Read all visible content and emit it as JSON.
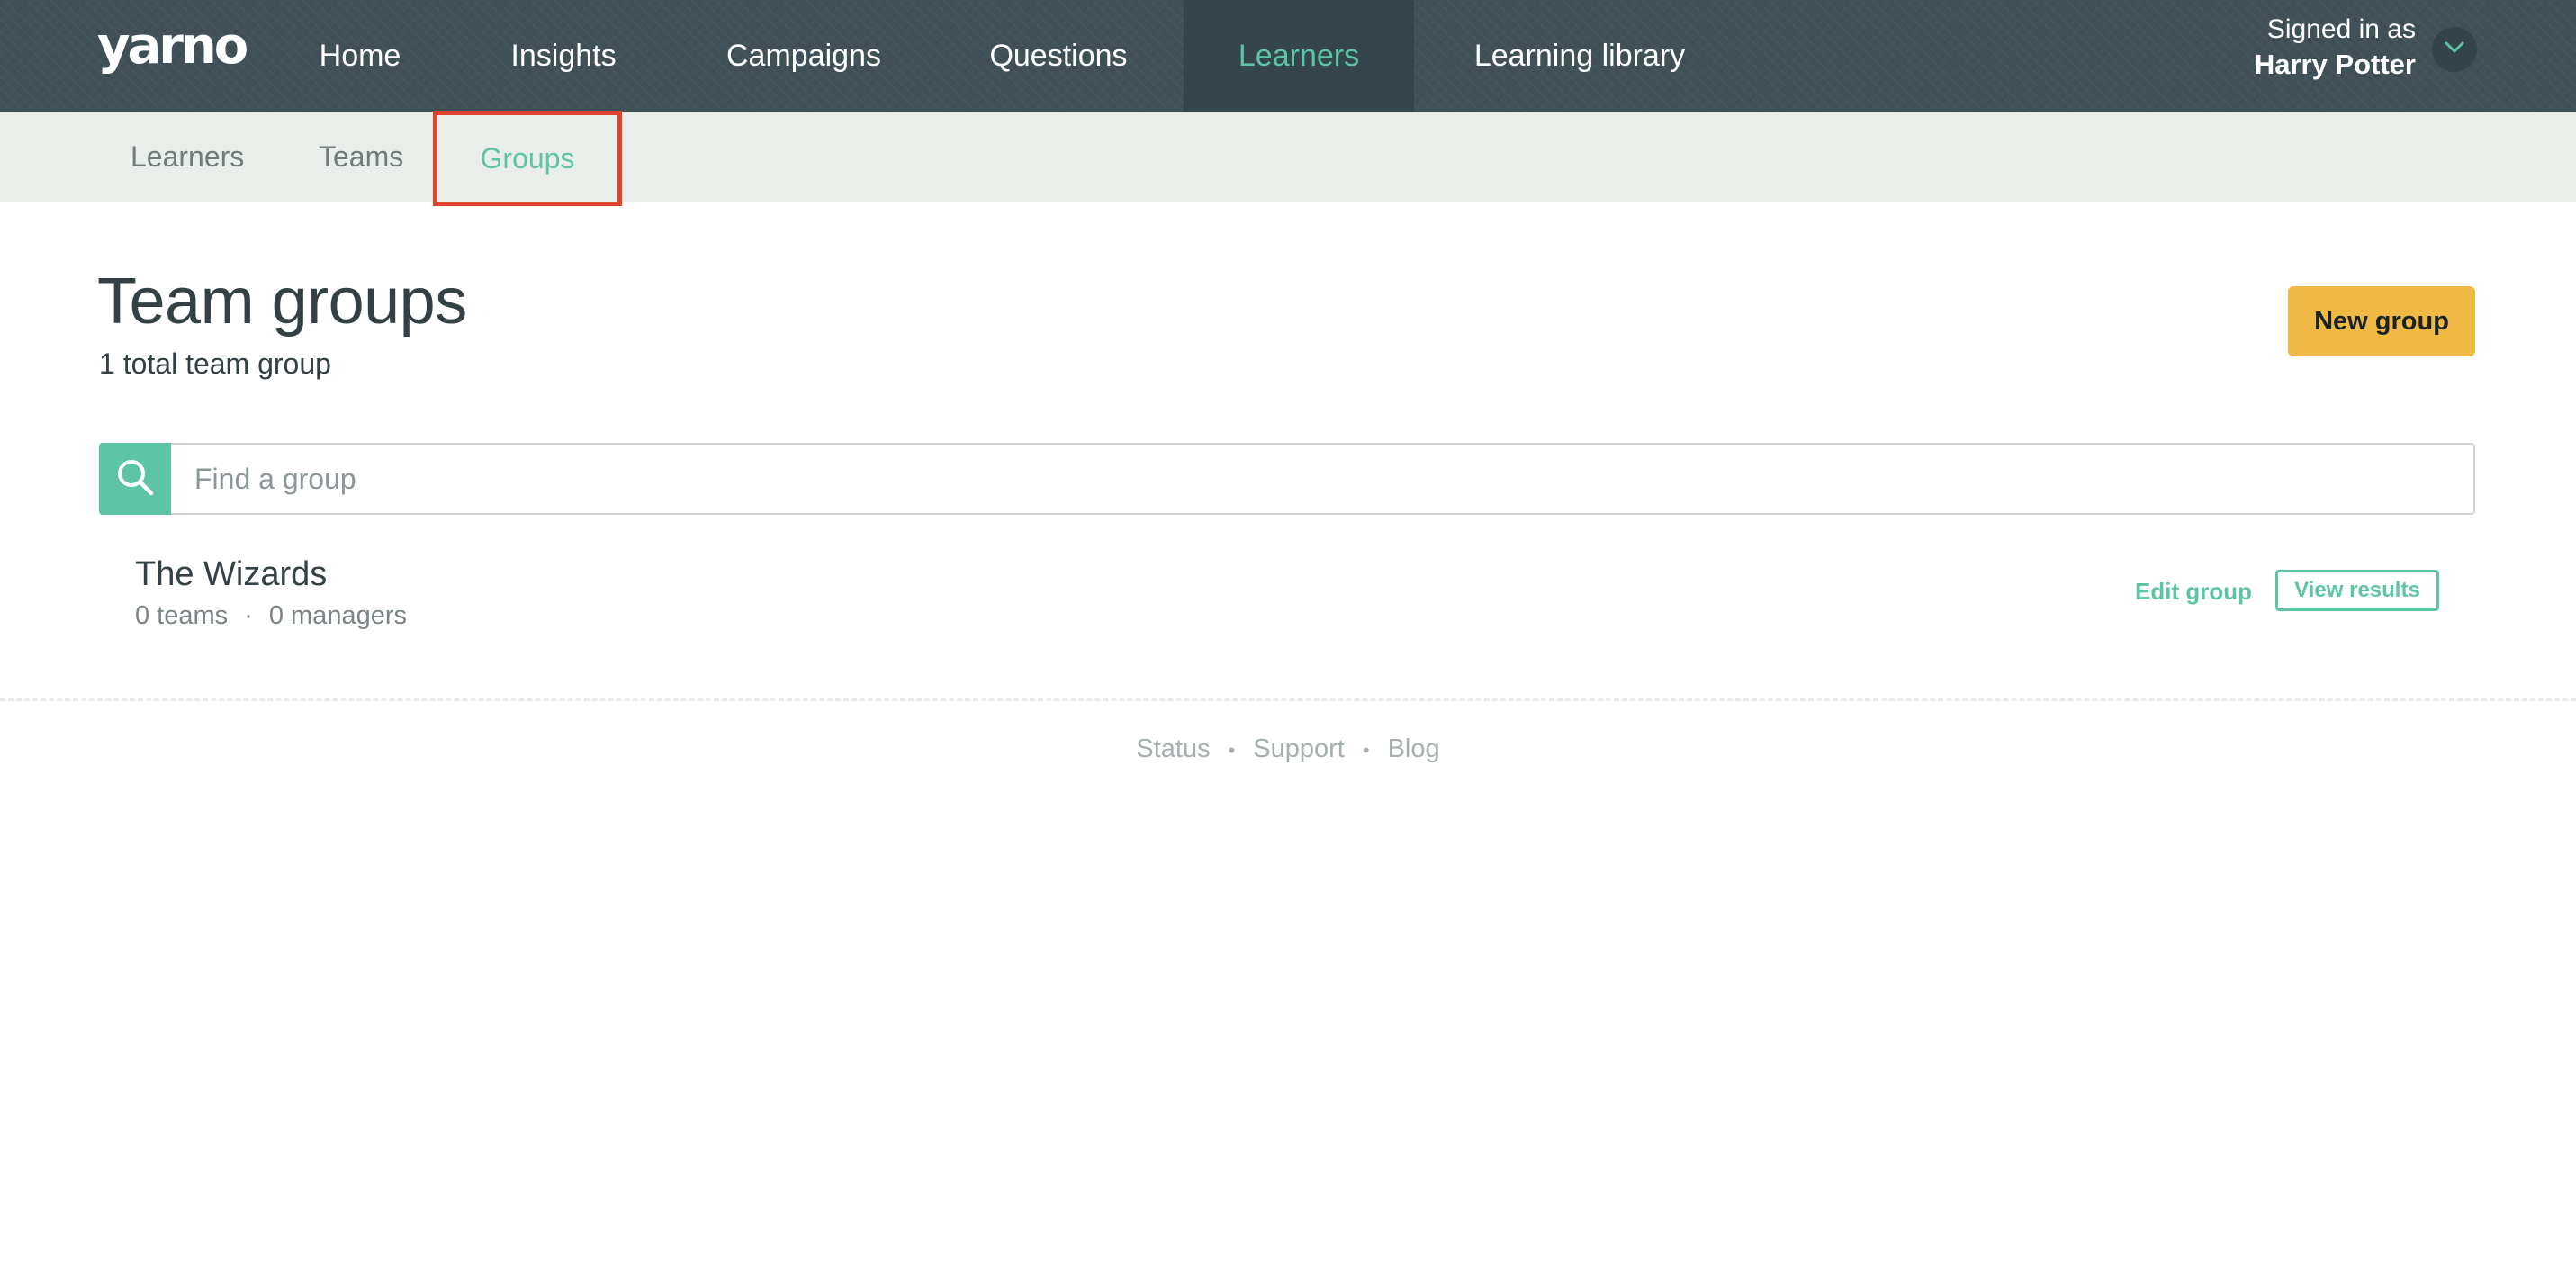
{
  "brand": {
    "logo_text": "yarno"
  },
  "topnav": {
    "items": [
      {
        "label": "Home"
      },
      {
        "label": "Insights"
      },
      {
        "label": "Campaigns"
      },
      {
        "label": "Questions"
      },
      {
        "label": "Learners",
        "active": true
      },
      {
        "label": "Learning library"
      }
    ]
  },
  "account": {
    "signed_in_label": "Signed in as",
    "user_name": "Harry Potter",
    "menu_icon": "chevron-down-icon"
  },
  "subnav": {
    "items": [
      {
        "label": "Learners"
      },
      {
        "label": "Teams"
      },
      {
        "label": "Groups",
        "active": true
      }
    ]
  },
  "page": {
    "title": "Team groups",
    "subtitle": "1 total team group",
    "new_button_label": "New group"
  },
  "search": {
    "icon": "search-icon",
    "placeholder": "Find a group",
    "value": ""
  },
  "groups": [
    {
      "name": "The Wizards",
      "teams": "0 teams",
      "managers": "0 managers",
      "meta_separator": "·",
      "edit_label": "Edit group",
      "view_label": "View results"
    }
  ],
  "footer": {
    "links": [
      "Status",
      "Support",
      "Blog"
    ],
    "separator": "•"
  },
  "colors": {
    "header_bg": "#3f5157",
    "accent": "#5ec4a6",
    "primary_button": "#f0b944",
    "subnav_bg": "#eaeeeb",
    "highlight_box": "#e0452b"
  }
}
